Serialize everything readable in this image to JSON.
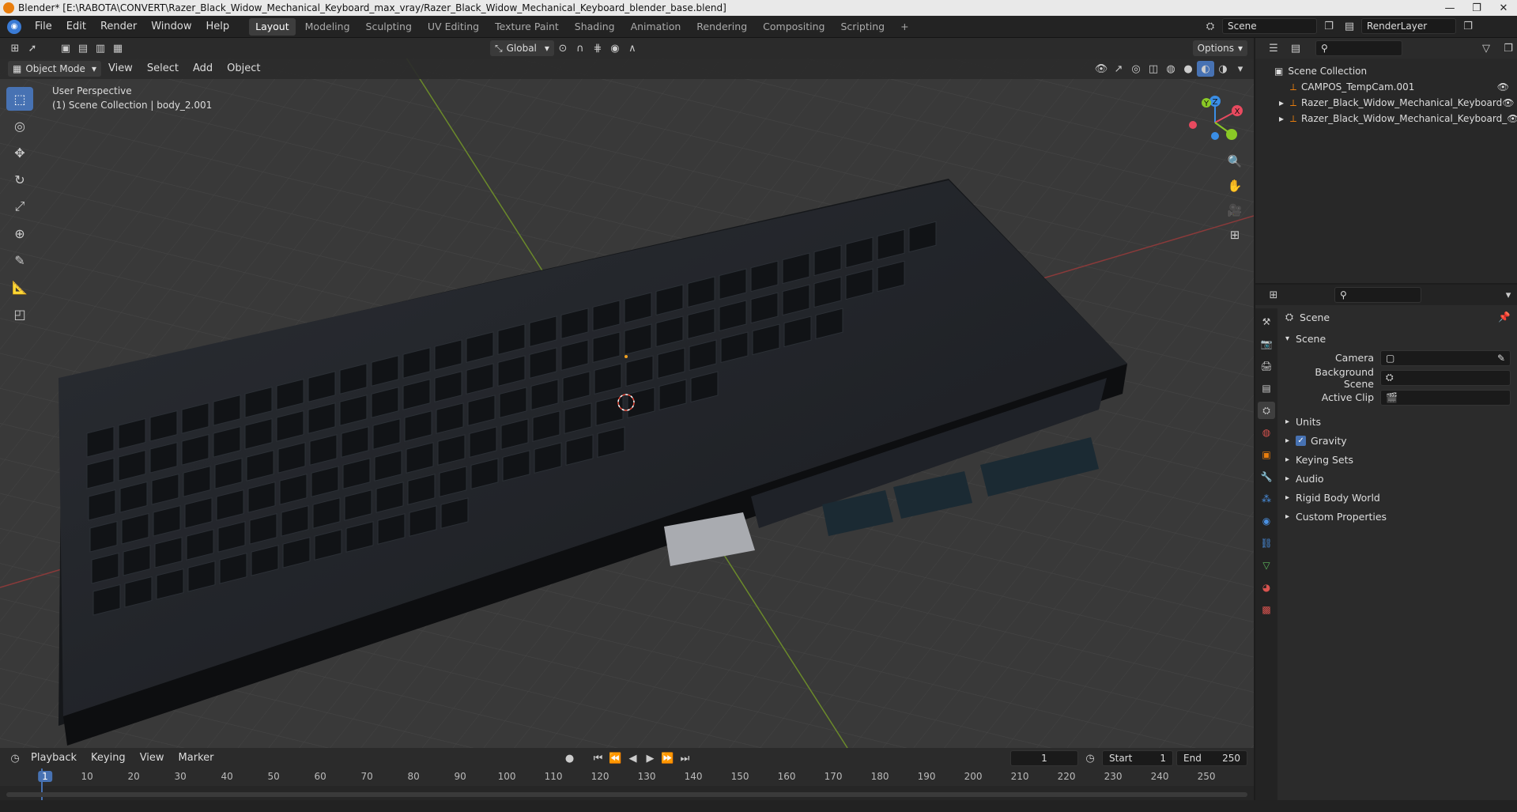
{
  "window": {
    "title": "Blender* [E:\\RABOTA\\CONVERT\\Razer_Black_Widow_Mechanical_Keyboard_max_vray/Razer_Black_Widow_Mechanical_Keyboard_blender_base.blend]",
    "controls": [
      "—",
      "❐",
      "✕"
    ]
  },
  "menubar": {
    "items": [
      "File",
      "Edit",
      "Render",
      "Window",
      "Help"
    ]
  },
  "workspaces": {
    "tabs": [
      "Layout",
      "Modeling",
      "Sculpting",
      "UV Editing",
      "Texture Paint",
      "Shading",
      "Animation",
      "Rendering",
      "Compositing",
      "Scripting"
    ],
    "active": "Layout",
    "add": "+"
  },
  "scene_selector": {
    "scene": "Scene",
    "view_layer": "RenderLayer"
  },
  "viewport_header": {
    "transform_orientation": "Global",
    "options": "Options"
  },
  "viewport_menu": {
    "mode": "Object Mode",
    "items": [
      "View",
      "Select",
      "Add",
      "Object"
    ]
  },
  "viewport_info": {
    "perspective": "User Perspective",
    "collection": "(1) Scene Collection | body_2.001"
  },
  "gizmo": {
    "x": "X",
    "y": "Y",
    "z": "Z"
  },
  "outliner": {
    "root": "Scene Collection",
    "items": [
      {
        "label": "CAMPOS_TempCam.001",
        "expandable": false
      },
      {
        "label": "Razer_Black_Widow_Mechanical_Keyboard",
        "expandable": true
      },
      {
        "label": "Razer_Black_Widow_Mechanical_Keyboard_",
        "expandable": true
      }
    ]
  },
  "properties": {
    "context": "Scene",
    "panel": "Scene",
    "fields": [
      {
        "label": "Camera",
        "value": ""
      },
      {
        "label": "Background Scene",
        "value": ""
      },
      {
        "label": "Active Clip",
        "value": ""
      }
    ],
    "subpanels": [
      {
        "label": "Units",
        "checkbox": false
      },
      {
        "label": "Gravity",
        "checkbox": true
      },
      {
        "label": "Keying Sets",
        "checkbox": false
      },
      {
        "label": "Audio",
        "checkbox": false
      },
      {
        "label": "Rigid Body World",
        "checkbox": false
      },
      {
        "label": "Custom Properties",
        "checkbox": false
      }
    ]
  },
  "timeline": {
    "menus": [
      "Playback",
      "Keying",
      "View",
      "Marker"
    ],
    "current_frame": "1",
    "start_label": "Start",
    "start": "1",
    "end_label": "End",
    "end": "250",
    "ruler": [
      "1",
      "10",
      "20",
      "30",
      "40",
      "50",
      "60",
      "70",
      "80",
      "90",
      "100",
      "110",
      "120",
      "130",
      "140",
      "150",
      "160",
      "170",
      "180",
      "190",
      "200",
      "210",
      "220",
      "230",
      "240",
      "250"
    ]
  }
}
